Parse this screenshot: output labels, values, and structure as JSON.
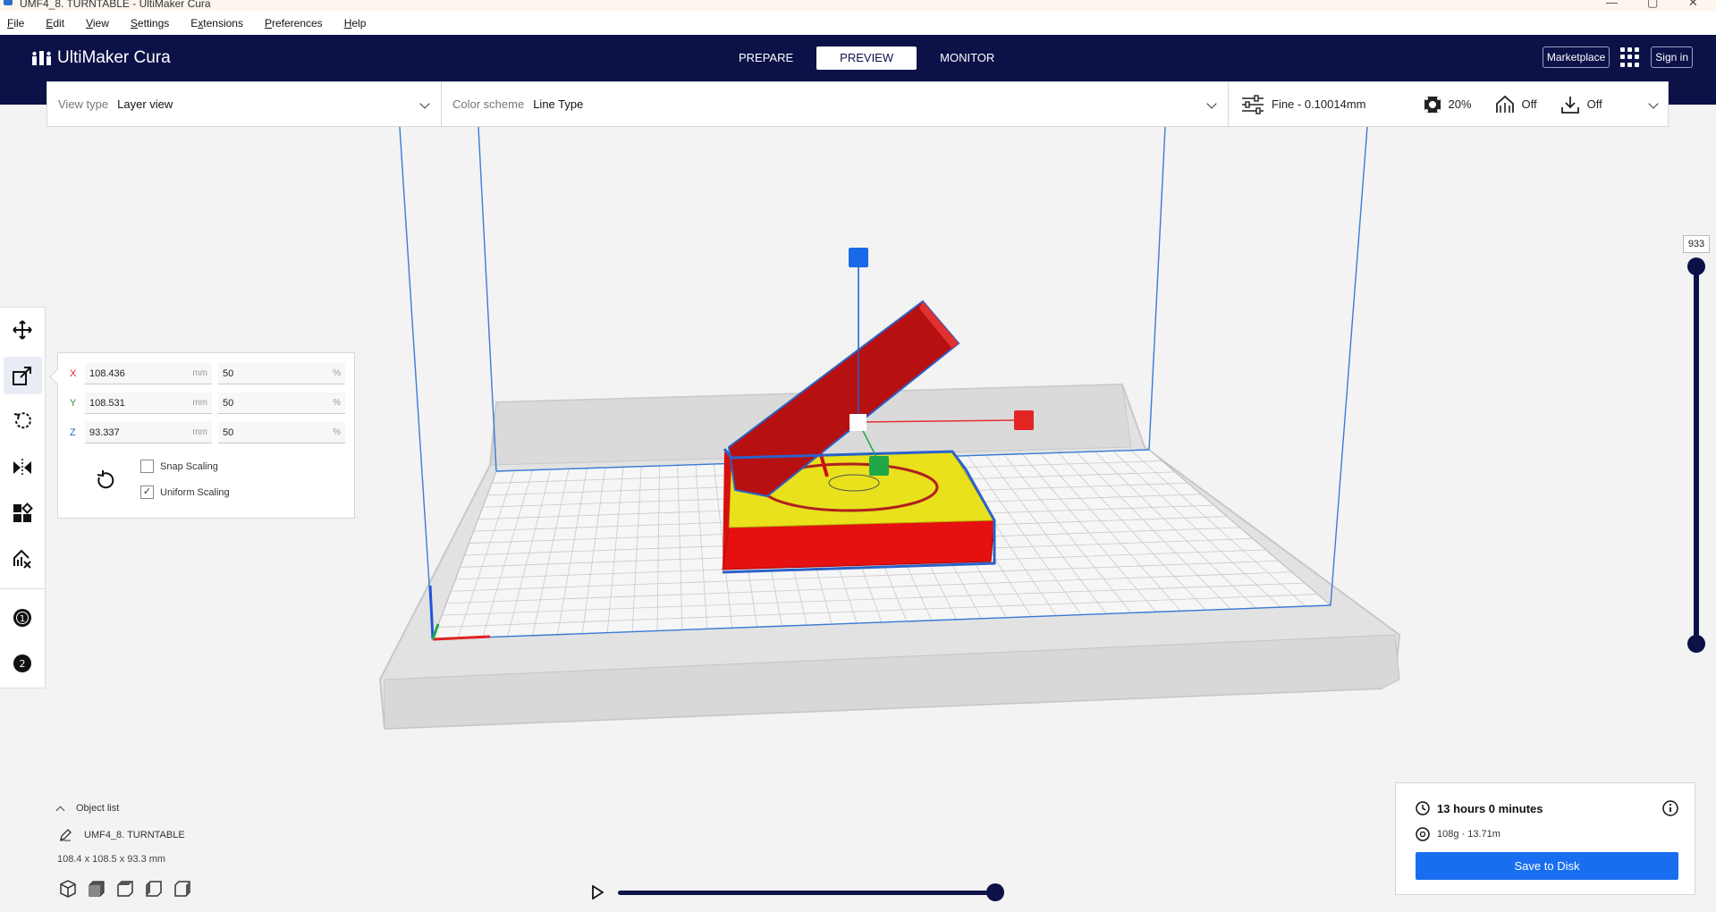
{
  "window": {
    "title": "UMF4_8. TURNTABLE - UltiMaker Cura",
    "controls": [
      "minimize-icon",
      "maximize-icon",
      "close-icon"
    ]
  },
  "menu": {
    "items": [
      {
        "label": "File",
        "mnemonic": "F",
        "rest": "ile"
      },
      {
        "label": "Edit",
        "mnemonic": "E",
        "rest": "dit"
      },
      {
        "label": "View",
        "mnemonic": "V",
        "rest": "iew"
      },
      {
        "label": "Settings",
        "mnemonic": "S",
        "rest": "ettings"
      },
      {
        "label": "Extensions",
        "mnemonic": "x",
        "prefix": "E",
        "rest": "tensions"
      },
      {
        "label": "Preferences",
        "mnemonic": "P",
        "rest": "references"
      },
      {
        "label": "Help",
        "mnemonic": "H",
        "rest": "elp"
      }
    ]
  },
  "header": {
    "app_name": "UltiMaker Cura",
    "stages": [
      "PREPARE",
      "PREVIEW",
      "MONITOR"
    ],
    "active_stage": "PREVIEW",
    "marketplace_label": "Marketplace",
    "signin_label": "Sign in"
  },
  "toolbar": {
    "view_type_label": "View type",
    "view_type_value": "Layer view",
    "color_scheme_label": "Color scheme",
    "color_scheme_value": "Line Type",
    "profile": "Fine - 0.10014mm",
    "infill": "20%",
    "support": "Off",
    "adhesion": "Off"
  },
  "left_tools": [
    "move-icon",
    "scale-icon",
    "rotate-icon",
    "mirror-icon",
    "per-model-settings-icon",
    "support-blocker-icon",
    "extruder-1-icon",
    "extruder-2-icon"
  ],
  "scale_panel": {
    "x_label": "X",
    "x_mm": "108.436",
    "x_pct": "50",
    "y_label": "Y",
    "y_mm": "108.531",
    "y_pct": "50",
    "z_label": "Z",
    "z_mm": "93.337",
    "z_pct": "50",
    "mm_unit": "mm",
    "pct_unit": "%",
    "snap_scaling_label": "Snap Scaling",
    "snap_scaling_checked": false,
    "uniform_scaling_label": "Uniform Scaling",
    "uniform_scaling_checked": true
  },
  "layer_slider": {
    "current_layer": "933",
    "value_fraction": 1.0
  },
  "object_list": {
    "toggle_label": "Object list",
    "object_name": "UMF4_8. TURNTABLE",
    "dimensions": "108.4 x 108.5 x 93.3 mm"
  },
  "simulation": {
    "progress": 1.0
  },
  "print_info": {
    "time": "13 hours 0 minutes",
    "material": "108g · 13.71m",
    "save_label": "Save to Disk"
  },
  "colors": {
    "header_bg": "#0c1148",
    "accent_blue": "#196ef0",
    "print_red": "#ee1111",
    "print_yellow": "#e8e817",
    "build_volume": "#3a7bd5"
  }
}
